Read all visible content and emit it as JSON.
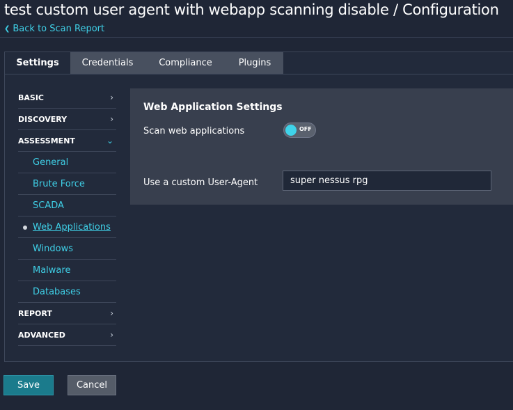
{
  "header": {
    "title": "test custom user agent with webapp scanning disable / Configuration",
    "back_link": "Back to Scan Report"
  },
  "tabs": [
    {
      "label": "Settings",
      "active": true
    },
    {
      "label": "Credentials",
      "active": false
    },
    {
      "label": "Compliance",
      "active": false
    },
    {
      "label": "Plugins",
      "active": false
    }
  ],
  "sidebar": {
    "basic": "BASIC",
    "discovery": "DISCOVERY",
    "assessment": "ASSESSMENT",
    "assessment_items": [
      "General",
      "Brute Force",
      "SCADA",
      "Web Applications",
      "Windows",
      "Malware",
      "Databases"
    ],
    "current_item": "Web Applications",
    "report": "REPORT",
    "advanced": "ADVANCED"
  },
  "content": {
    "section_title": "Web Application Settings",
    "scan_label": "Scan web applications",
    "scan_toggle_state": "OFF",
    "user_agent_label": "Use a custom User-Agent",
    "user_agent_value": "super nessus rpg"
  },
  "actions": {
    "save_label": "Save",
    "cancel_label": "Cancel"
  },
  "colors": {
    "accent": "#3fcfe6",
    "background": "#1f2636",
    "save_button": "#1b7b8c"
  },
  "icons": {
    "back": "chevron-left-icon",
    "collapsed": "chevron-right-icon",
    "expanded": "chevron-down-icon",
    "current": "bullet-icon"
  }
}
